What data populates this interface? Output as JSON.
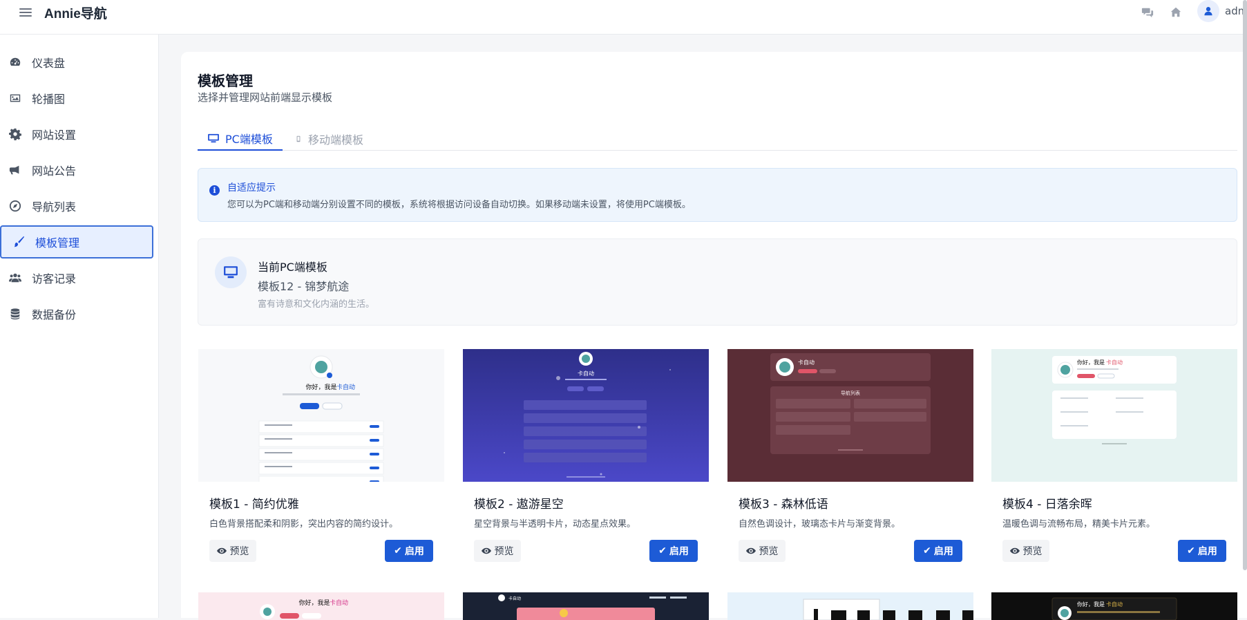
{
  "header": {
    "brand": "Annie导航",
    "menu_icon": "menu-icon",
    "icons": [
      "comments-icon",
      "home-icon",
      "user-icon"
    ],
    "username": "adm"
  },
  "sidebar": {
    "items": [
      {
        "label": "仪表盘",
        "icon": "dashboard-icon"
      },
      {
        "label": "轮播图",
        "icon": "image-icon"
      },
      {
        "label": "网站设置",
        "icon": "gear-icon"
      },
      {
        "label": "网站公告",
        "icon": "megaphone-icon"
      },
      {
        "label": "导航列表",
        "icon": "compass-icon"
      },
      {
        "label": "模板管理",
        "icon": "paintbrush-icon",
        "active": true
      },
      {
        "label": "访客记录",
        "icon": "users-icon"
      },
      {
        "label": "数据备份",
        "icon": "database-icon"
      }
    ]
  },
  "page": {
    "title": "模板管理",
    "subtitle": "选择并管理网站前端显示模板"
  },
  "tabs": [
    {
      "label": "PC端模板",
      "icon": "desktop-icon",
      "active": true
    },
    {
      "label": "移动端模板",
      "icon": "mobile-icon",
      "active": false
    }
  ],
  "alert": {
    "title": "自适应提示",
    "body": "您可以为PC端和移动端分别设置不同的模板，系统将根据访问设备自动切换。如果移动端未设置，将使用PC端模板。"
  },
  "current": {
    "label": "当前PC端模板",
    "name": "模板12 - 锦梦航途",
    "desc": "富有诗意和文化内涵的生活。"
  },
  "buttons": {
    "preview": "预览",
    "enable": "启用"
  },
  "templates": [
    {
      "name": "模板1 - 简约优雅",
      "desc": "白色背景搭配柔和阴影，突出内容的简约设计。",
      "thumb_bg": "#f7f8fa"
    },
    {
      "name": "模板2 - 遨游星空",
      "desc": "星空背景与半透明卡片，动态星点效果。",
      "thumb_bg": "#3b3a9e"
    },
    {
      "name": "模板3 - 森林低语",
      "desc": "自然色调设计，玻璃态卡片与渐变背景。",
      "thumb_bg": "#5a2d36"
    },
    {
      "name": "模板4 - 日落余晖",
      "desc": "温暖色调与流畅布局，精美卡片元素。",
      "thumb_bg": "#e6f3f2"
    }
  ],
  "thumb_text": {
    "hello": "你好，我是",
    "brand": "卡自动",
    "nav": "导航列表"
  },
  "colors": {
    "accent": "#1d5bd6",
    "active_bg": "#e7efff"
  }
}
